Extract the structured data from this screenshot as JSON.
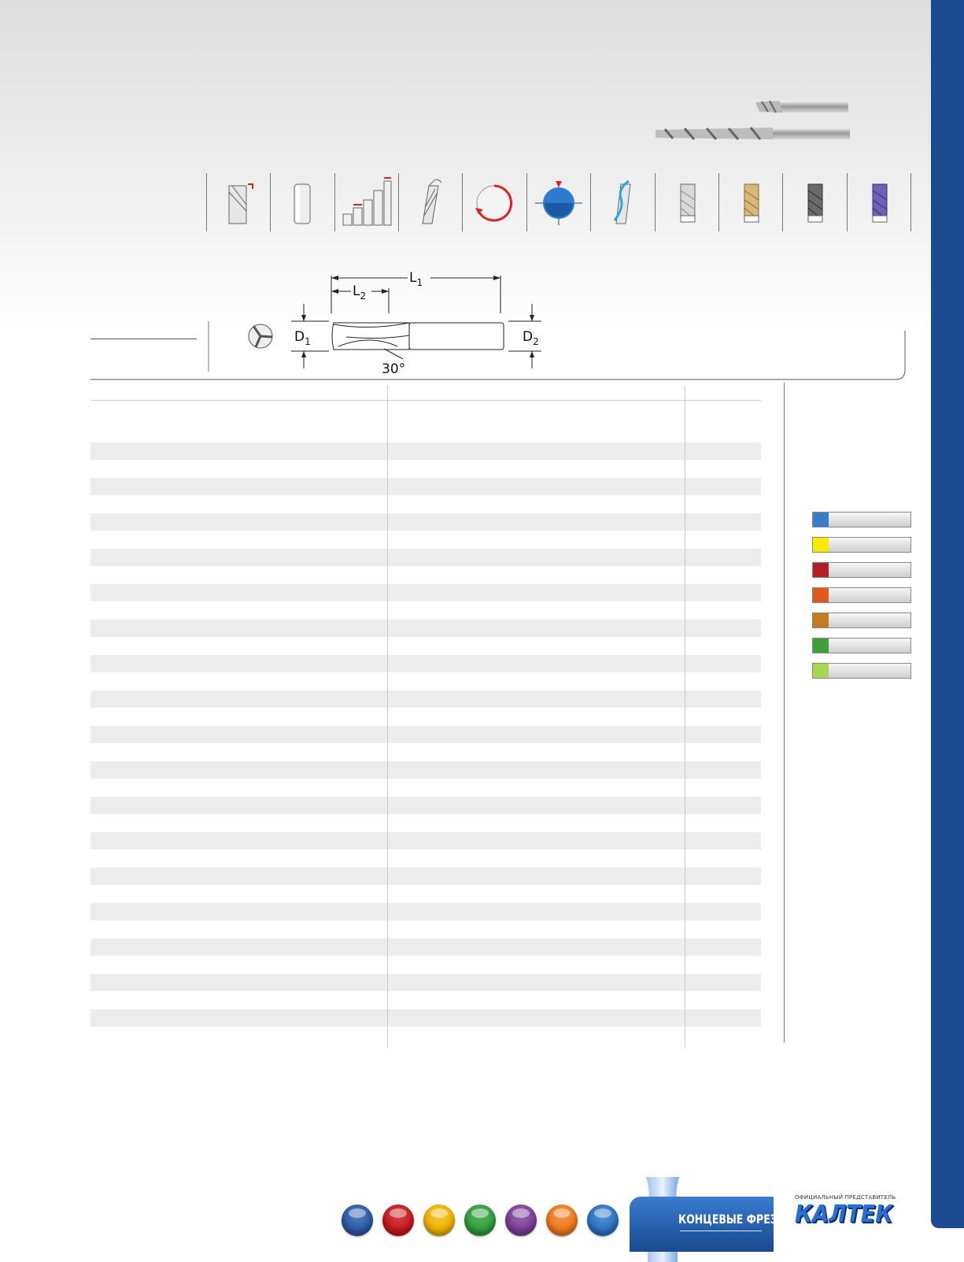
{
  "diagram": {
    "l1_label": "L",
    "l1_sub": "1",
    "l2_label": "L",
    "l2_sub": "2",
    "d1_label": "D",
    "d1_sub": "1",
    "d2_label": "D",
    "d2_sub": "2",
    "angle_label": "30°"
  },
  "icons": [
    {
      "name": "helix-flute-icon"
    },
    {
      "name": "plain-shank-icon"
    },
    {
      "name": "tolerance-bars-icon"
    },
    {
      "name": "helix-angle-icon"
    },
    {
      "name": "rotation-direction-icon"
    },
    {
      "name": "center-cutting-icon"
    },
    {
      "name": "coolant-flute-icon"
    },
    {
      "name": "uncoated-tool-icon"
    },
    {
      "name": "tin-coated-tool-icon"
    },
    {
      "name": "altin-coated-tool-icon"
    },
    {
      "name": "ticn-coated-tool-icon"
    }
  ],
  "legend_colors": [
    "#3b7cc9",
    "#f7ec00",
    "#b11f24",
    "#e05a1e",
    "#c67a22",
    "#3f9e3a",
    "#a6d654"
  ],
  "applications": [
    {
      "name": "aerospace-icon",
      "color": "#2b5aa8"
    },
    {
      "name": "medical-icon",
      "color": "#c8161d"
    },
    {
      "name": "energy-icon",
      "color": "#f0b400"
    },
    {
      "name": "automotive-icon",
      "color": "#2f9e3a"
    },
    {
      "name": "electronics-icon",
      "color": "#7b3f98"
    },
    {
      "name": "die-mold-icon",
      "color": "#f07a1a"
    },
    {
      "name": "general-engineering-icon",
      "color": "#2a74c4"
    }
  ],
  "brand": {
    "title": "КОНЦЕВЫЕ ФРЕЗЫ",
    "rep_label": "ОФИЦИАЛЬНЫЙ ПРЕДСТАВИТЕЛЬ",
    "logo": "КАЛТЕК"
  }
}
